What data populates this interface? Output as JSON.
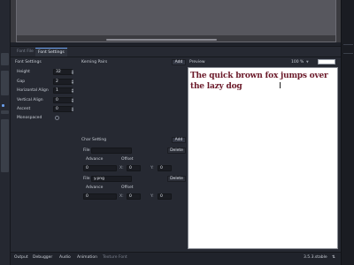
{
  "tabs": [
    {
      "label": "Font File",
      "active": false
    },
    {
      "label": "Font Settings",
      "active": true
    }
  ],
  "font_settings": {
    "header": "Font Settings",
    "rows": [
      {
        "label": "Height",
        "value": "32"
      },
      {
        "label": "Gap",
        "value": "2"
      },
      {
        "label": "Horizontal Align",
        "value": "1"
      },
      {
        "label": "Vertical Align",
        "value": "0"
      },
      {
        "label": "Ascent",
        "value": "0"
      },
      {
        "label": "Monospaced",
        "value": ""
      }
    ]
  },
  "kerning": {
    "header": "Kerning Pairs",
    "add_label": "Add"
  },
  "preview": {
    "header": "Preview",
    "zoom": "100 %",
    "sample_text": "The quick brown fox jumps over the lazy dog",
    "bg_color": "#ffffff",
    "text_color": "#6b1a2a"
  },
  "char_setting": {
    "header": "Char Setting",
    "add_label": "Add",
    "entries": [
      {
        "file_label": "File",
        "file_value": "",
        "delete_label": "Delete",
        "advance_label": "Advance",
        "offset_label": "Offset",
        "advance": "0",
        "offset_x": "0",
        "offset_y": "0",
        "x_label": "X:",
        "y_label": "Y:"
      },
      {
        "file_label": "File",
        "file_value": "y.png",
        "delete_label": "Delete",
        "advance_label": "Advance",
        "offset_label": "Offset",
        "advance": "0",
        "offset_x": "0",
        "offset_y": "0",
        "x_label": "X:",
        "y_label": "Y:"
      }
    ]
  },
  "statusbar": {
    "items": [
      "Output",
      "Debugger",
      "Audio",
      "Animation",
      "Texture Font"
    ],
    "version": "3.5.3.stable"
  },
  "colors": {
    "accent": "#699ce8",
    "panel_bg": "#262932",
    "editor_bg": "#1e2129"
  }
}
